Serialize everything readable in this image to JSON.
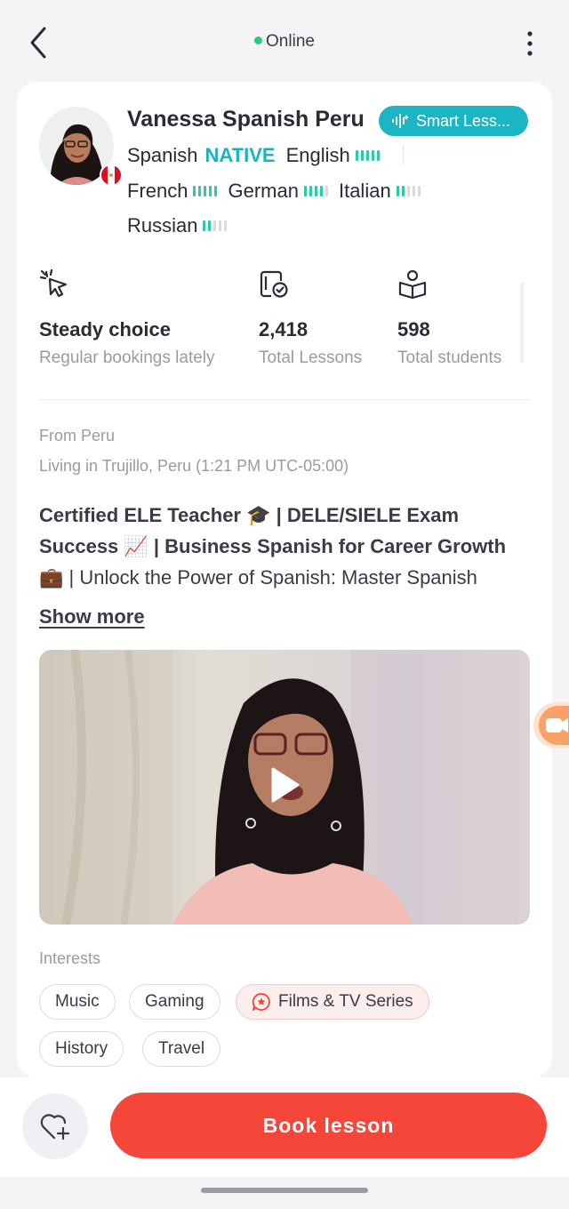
{
  "header": {
    "status_text": "Online"
  },
  "tutor": {
    "name": "Vanessa Spanish Peru",
    "badge_label": "Smart Less...",
    "languages": [
      {
        "name": "Spanish",
        "level_label": "NATIVE"
      },
      {
        "name": "English",
        "level": 5
      },
      {
        "name": "French",
        "level": 5
      },
      {
        "name": "German",
        "level": 4
      },
      {
        "name": "Italian",
        "level": 2
      },
      {
        "name": "Russian",
        "level": 2
      }
    ],
    "flag_icon": "peru-flag-icon"
  },
  "stats": [
    {
      "icon": "cursor-sparkle-icon",
      "value": "Steady choice",
      "label": "Regular bookings lately"
    },
    {
      "icon": "lessons-check-icon",
      "value": "2,418",
      "label": "Total Lessons"
    },
    {
      "icon": "students-book-icon",
      "value": "598",
      "label": "Total students"
    }
  ],
  "profile": {
    "from": "From Peru",
    "living": "Living in Trujillo, Peru (1:21 PM UTC-05:00)",
    "bio_line1": "Certified ELE Teacher 🎓 | DELE/SIELE Exam",
    "bio_line2": "Success 📈 | Business Spanish for Career Growth",
    "bio_line3": "💼 | Unlock the Power of Spanish: Master Spanish",
    "show_more": "Show more"
  },
  "interests": {
    "title": "Interests",
    "items": [
      "Music",
      "Gaming",
      "Films & TV Series",
      "History",
      "Travel"
    ]
  },
  "actions": {
    "book_label": "Book lesson"
  },
  "colors": {
    "accent_teal": "#1bb5c4",
    "level_green": "#2ec9a6",
    "book_red": "#f5463a",
    "online_green": "#2cc97c"
  }
}
